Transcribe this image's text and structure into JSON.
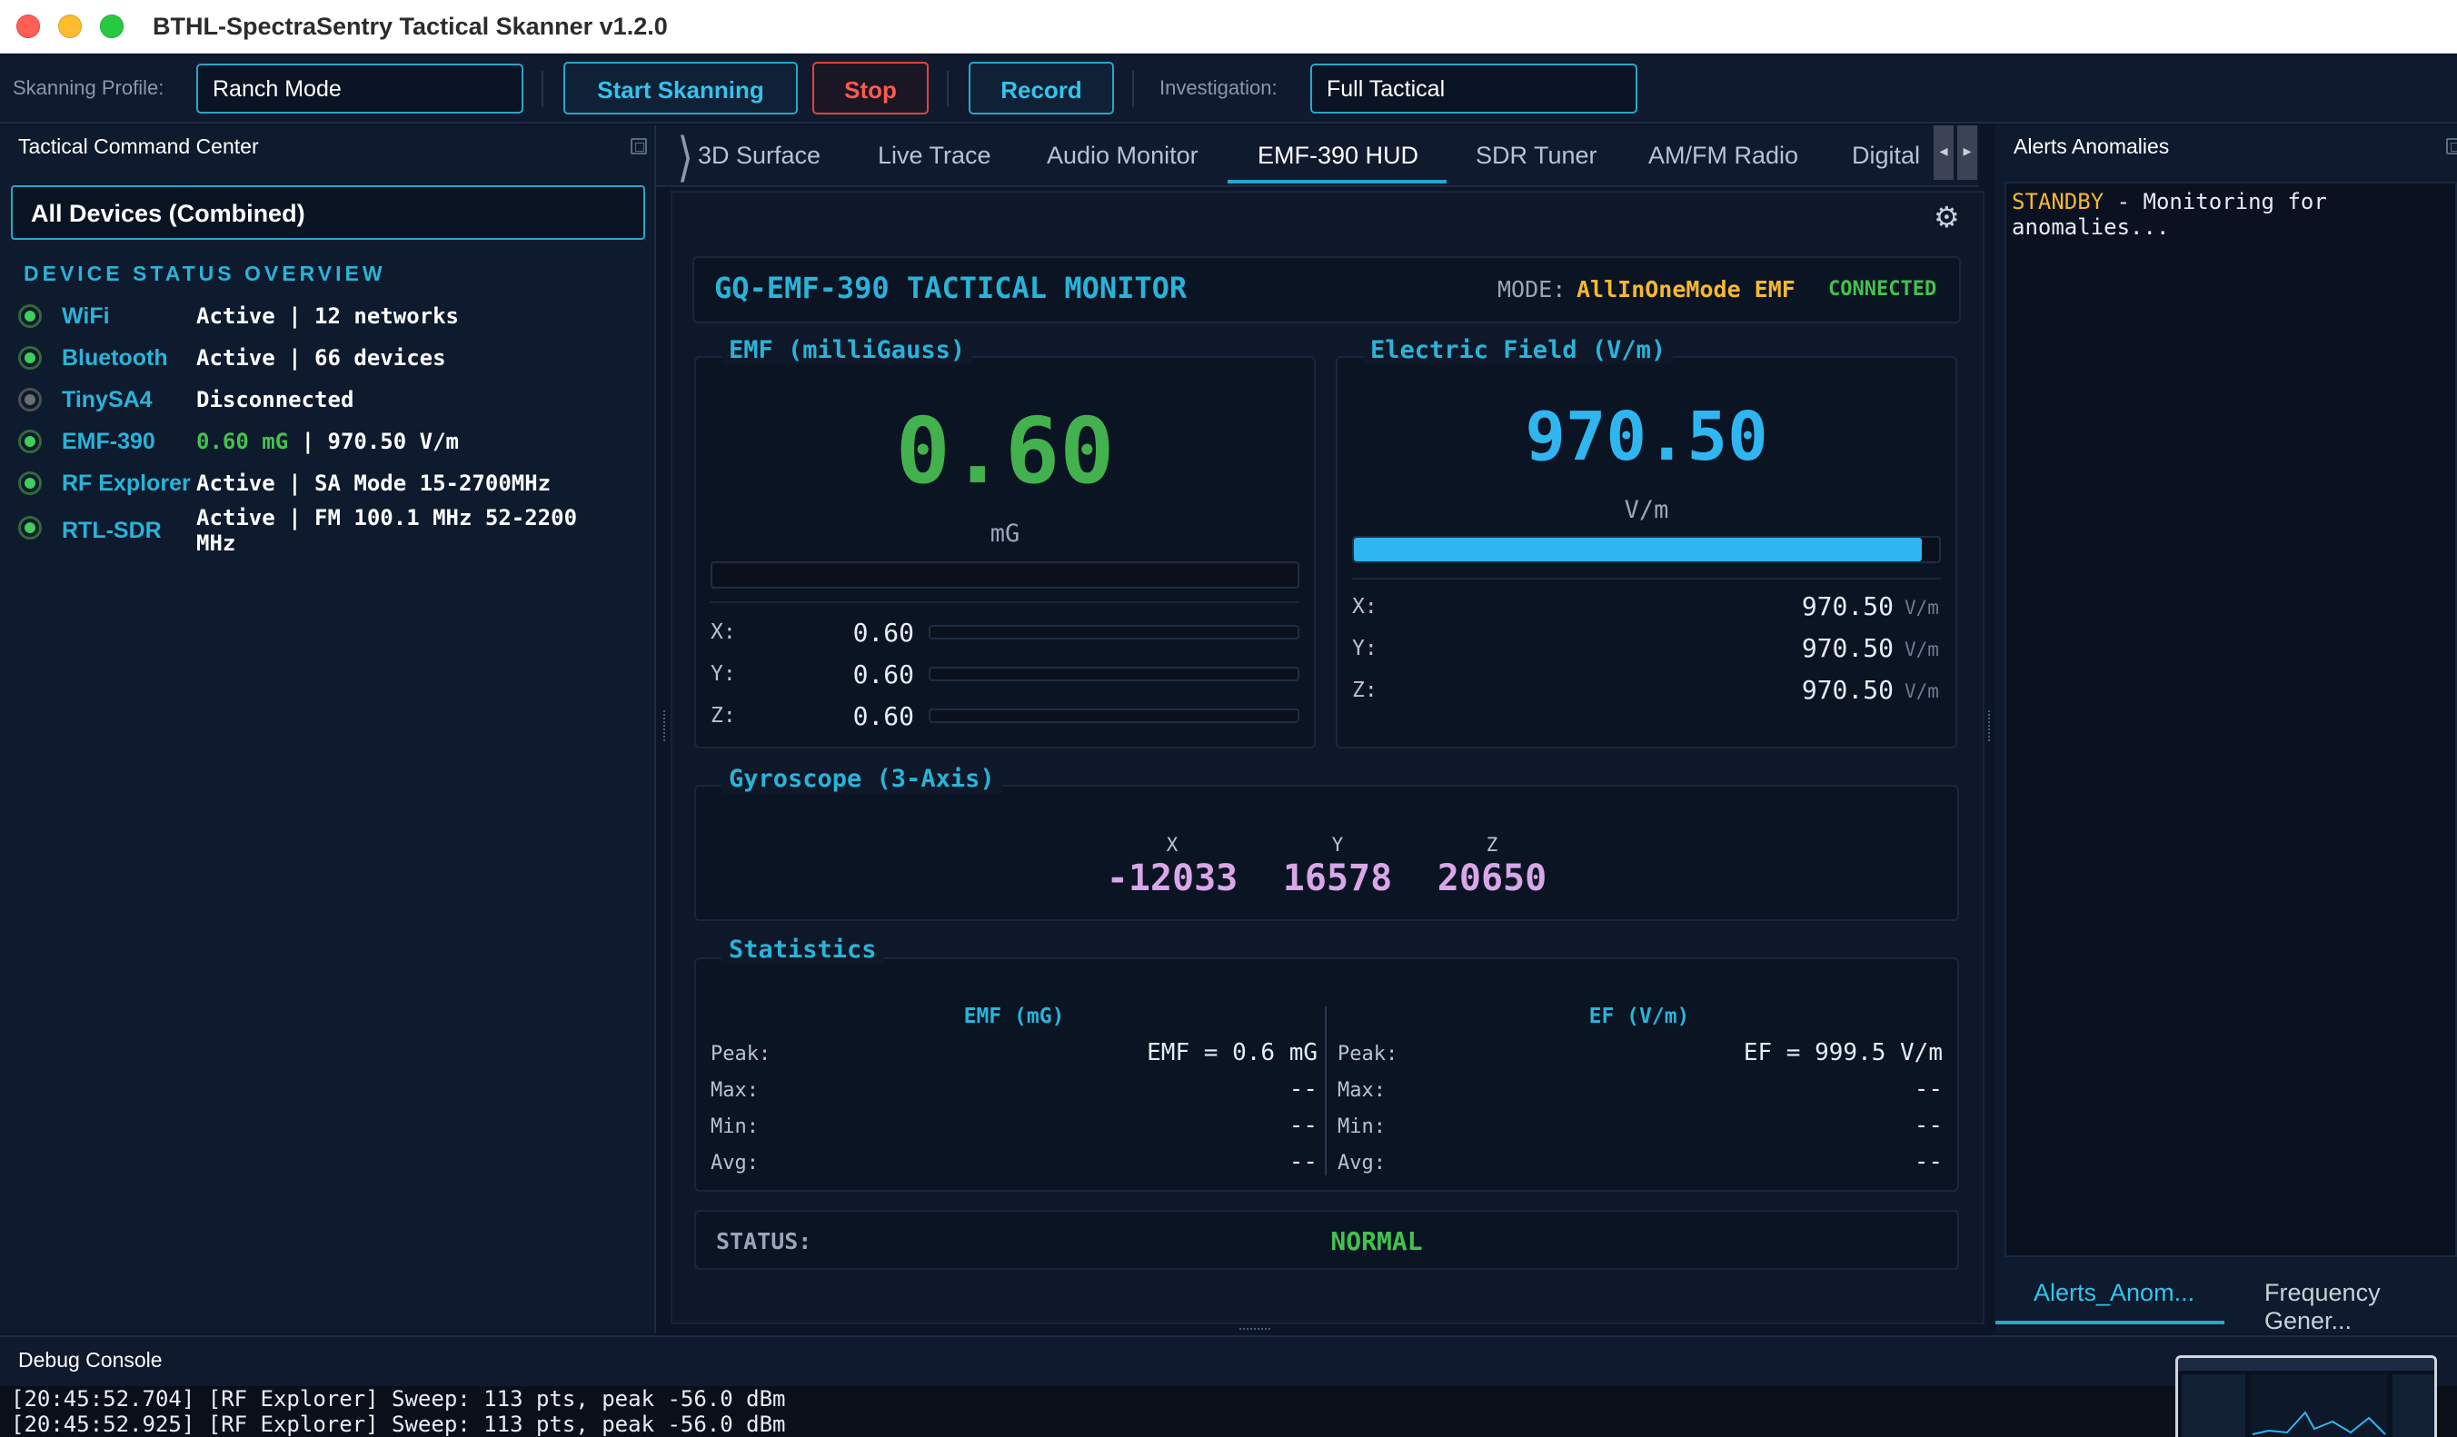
{
  "window": {
    "title": "BTHL-SpectraSentry Tactical Skanner v1.2.0"
  },
  "toolbar": {
    "profile_label": "Skanning Profile:",
    "profile_value": "Ranch Mode",
    "start_label": "Start Skanning",
    "stop_label": "Stop",
    "record_label": "Record",
    "investigation_label": "Investigation:",
    "investigation_value": "Full Tactical"
  },
  "left_panel": {
    "title": "Tactical Command Center",
    "device_select": "All Devices (Combined)",
    "overview_title": "DEVICE STATUS OVERVIEW",
    "devices": [
      {
        "name": "WiFi",
        "status": "Active | 12 networks",
        "state": "online"
      },
      {
        "name": "Bluetooth",
        "status": "Active | 66 devices",
        "state": "online"
      },
      {
        "name": "TinySA4",
        "status": "Disconnected",
        "state": "offline"
      },
      {
        "name": "EMF-390",
        "status_emf": "0.60 mG",
        "status_rest": " | 970.50 V/m",
        "state": "online"
      },
      {
        "name": "RF Explorer",
        "status": "Active | SA Mode  15-2700MHz",
        "state": "online"
      },
      {
        "name": "RTL-SDR",
        "status": "Active | FM 100.1 MHz  52-2200 MHz",
        "state": "online"
      }
    ]
  },
  "tabs": [
    {
      "label": "3D Surface"
    },
    {
      "label": "Live Trace"
    },
    {
      "label": "Audio Monitor"
    },
    {
      "label": "EMF-390 HUD",
      "active": true
    },
    {
      "label": "SDR Tuner"
    },
    {
      "label": "AM/FM Radio"
    },
    {
      "label": "Digital"
    }
  ],
  "hud": {
    "title": "GQ-EMF-390 TACTICAL MONITOR",
    "mode_label": "MODE:",
    "mode_value": "AllInOneMode EMF",
    "connection": "CONNECTED",
    "emf": {
      "group_title": "EMF (milliGauss)",
      "value": "0.60",
      "unit": "mG",
      "level_fraction": 0.0,
      "axes": [
        {
          "label": "X:",
          "value": "0.60"
        },
        {
          "label": "Y:",
          "value": "0.60"
        },
        {
          "label": "Z:",
          "value": "0.60"
        }
      ]
    },
    "ef": {
      "group_title": "Electric Field (V/m)",
      "value": "970.50",
      "unit": "V/m",
      "level_fraction": 0.97,
      "axes": [
        {
          "label": "X:",
          "value": "970.50",
          "unit": "V/m"
        },
        {
          "label": "Y:",
          "value": "970.50",
          "unit": "V/m"
        },
        {
          "label": "Z:",
          "value": "970.50",
          "unit": "V/m"
        }
      ]
    },
    "gyro": {
      "group_title": "Gyroscope (3-Axis)",
      "axes": [
        {
          "label": "X",
          "value": "-12033"
        },
        {
          "label": "Y",
          "value": "16578"
        },
        {
          "label": "Z",
          "value": "20650"
        }
      ]
    },
    "stats": {
      "group_title": "Statistics",
      "emf_head": "EMF (mG)",
      "ef_head": "EF (V/m)",
      "labels": [
        "Peak:",
        "Max:",
        "Min:",
        "Avg:"
      ],
      "emf_values": [
        "EMF = 0.6 mG",
        "--",
        "--",
        "--"
      ],
      "ef_values": [
        "EF = 999.5 V/m",
        "--",
        "--",
        "--"
      ]
    },
    "status_label": "STATUS:",
    "status_value": "NORMAL"
  },
  "right_panel": {
    "title": "Alerts  Anomalies",
    "alert_prefix": "STANDBY",
    "alert_rest": " - Monitoring for anomalies...",
    "tabs": [
      "Alerts_Anom...",
      "Frequency Gener..."
    ]
  },
  "debug": {
    "title": "Debug Console",
    "lines": [
      "[20:45:52.704] [RF Explorer] Sweep: 113 pts, peak -56.0 dBm",
      "[20:45:52.925] [RF Explorer] Sweep: 113 pts, peak -56.0 dBm"
    ]
  },
  "colors": {
    "accent": "#2aa6c9",
    "emf_green": "#43b14d",
    "ef_blue": "#2fb6f0",
    "mode_amber": "#f5b92e",
    "gyro_violet": "#d9a6e8",
    "stop_red": "#e0443b"
  }
}
